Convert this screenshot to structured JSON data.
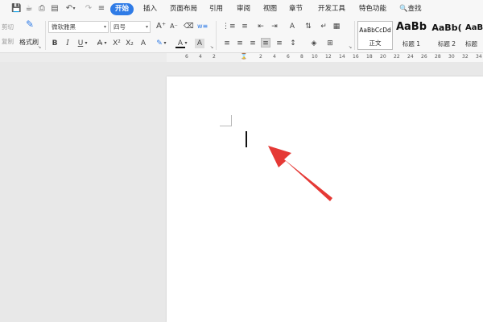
{
  "tabs": [
    "开始",
    "插入",
    "页面布局",
    "引用",
    "审阅",
    "视图",
    "章节",
    "开发工具",
    "特色功能"
  ],
  "search_label": "查找",
  "clipboard": {
    "cut": "剪切",
    "copy": "复制",
    "format_painter": "格式刷"
  },
  "font": {
    "name": "微软雅黑",
    "size": "四号"
  },
  "styles": [
    {
      "sample": "AaBbCcDd",
      "name": "正文"
    },
    {
      "sample": "AaBb",
      "name": "标题 1"
    },
    {
      "sample": "AaBb(",
      "name": "标题 2"
    },
    {
      "sample": "AaB",
      "name": "标题"
    }
  ],
  "ruler_labels": [
    "6",
    "4",
    "2",
    "2",
    "4",
    "6",
    "8",
    "10",
    "12",
    "14",
    "16",
    "18",
    "20",
    "22",
    "24",
    "26",
    "28",
    "30",
    "32",
    "34"
  ],
  "colors": {
    "accent": "#2f7be6",
    "annotation_arrow": "#e53935"
  },
  "icons": [
    "save-icon",
    "open-icon",
    "print-icon",
    "print-preview-icon",
    "undo-icon",
    "redo-icon",
    "customize-icon",
    "search-icon",
    "scissors-icon",
    "format-painter-icon"
  ]
}
